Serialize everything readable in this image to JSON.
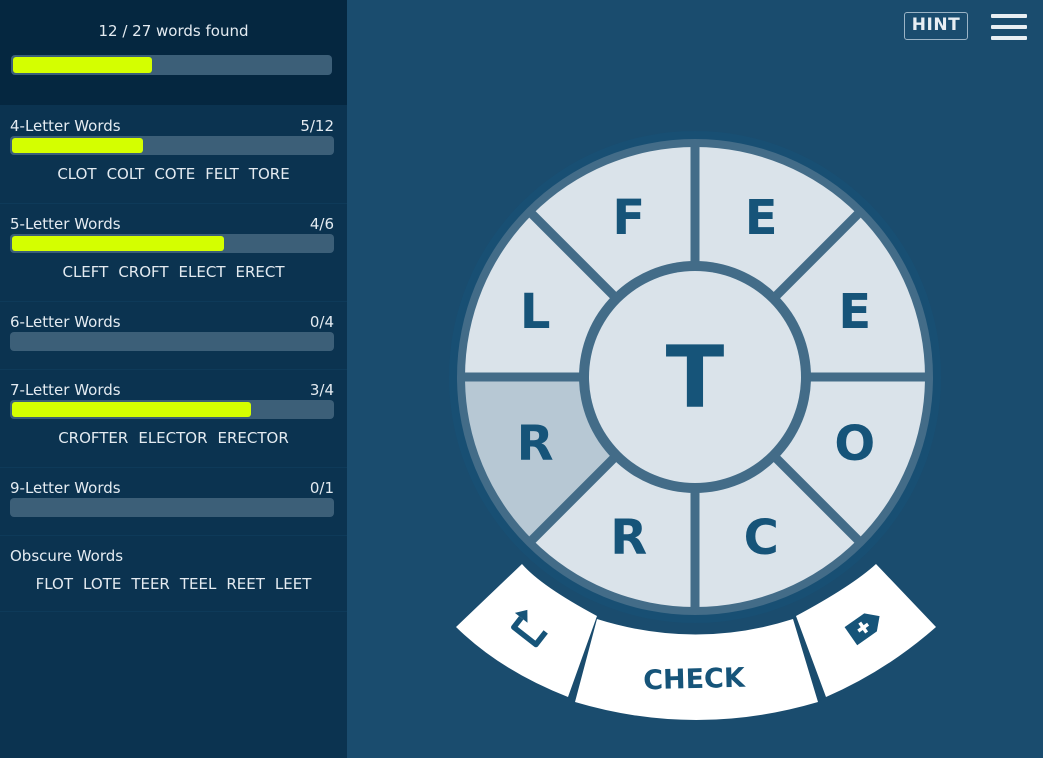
{
  "summary": {
    "found_text": "12 / 27 words found",
    "progress": 0.444
  },
  "groups": [
    {
      "title": "4-Letter Words",
      "count": "5/12",
      "progress": 0.417,
      "words": [
        "CLOT",
        "COLT",
        "COTE",
        "FELT",
        "TORE"
      ]
    },
    {
      "title": "5-Letter Words",
      "count": "4/6",
      "progress": 0.667,
      "words": [
        "CLEFT",
        "CROFT",
        "ELECT",
        "ERECT"
      ]
    },
    {
      "title": "6-Letter Words",
      "count": "0/4",
      "progress": 0,
      "words": []
    },
    {
      "title": "7-Letter Words",
      "count": "3/4",
      "progress": 0.75,
      "words": [
        "CROFTER",
        "ELECTOR",
        "ERECTOR"
      ]
    },
    {
      "title": "9-Letter Words",
      "count": "0/1",
      "progress": 0,
      "words": []
    }
  ],
  "obscure": {
    "title": "Obscure Words",
    "words": [
      "FLOT",
      "LOTE",
      "TEER",
      "TEEL",
      "REET",
      "LEET"
    ]
  },
  "header": {
    "hint_label": "HINT"
  },
  "wheel": {
    "center_letter": "T",
    "letters": [
      "E",
      "E",
      "O",
      "C",
      "R",
      "R",
      "L",
      "F"
    ],
    "selected_index": 5
  },
  "controls": {
    "check_label": "CHECK",
    "undo_icon": "undo-icon",
    "clear_icon": "clear-tag-icon"
  },
  "colors": {
    "accent": "#d4ff00",
    "wheel_segment": "#dae3ea",
    "wheel_selected": "#b7c8d4",
    "wheel_border": "#436c88",
    "letter": "#165479"
  }
}
